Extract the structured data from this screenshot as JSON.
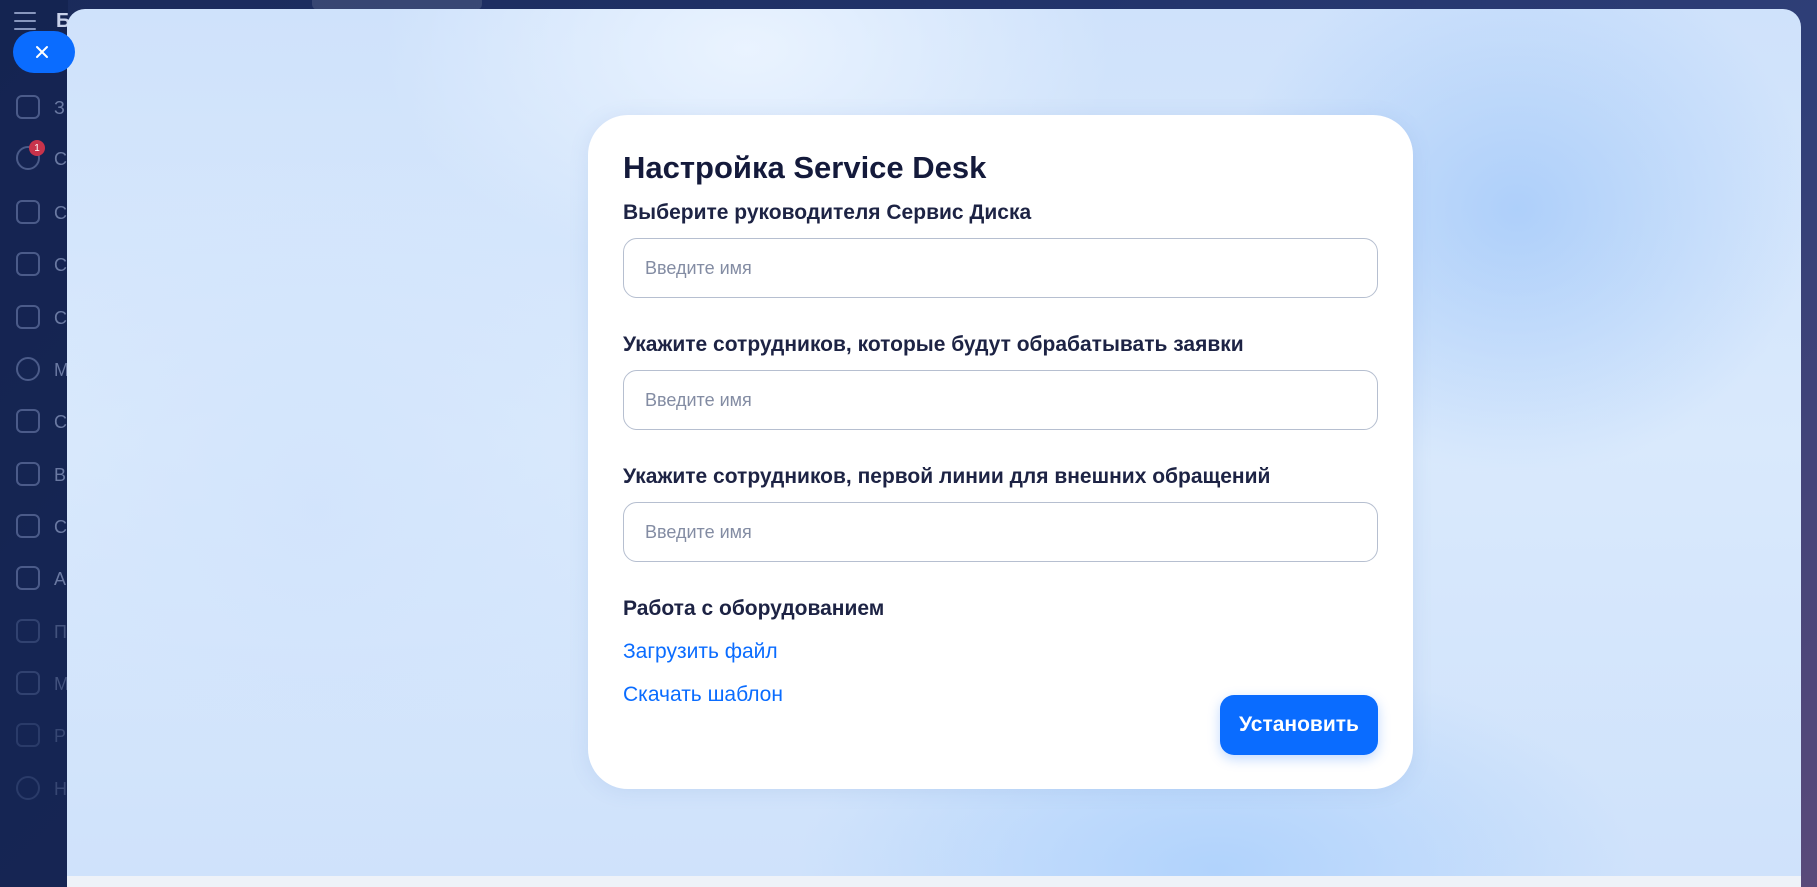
{
  "background": {
    "app_letter": "Б",
    "nav_badge": "1",
    "nav_items": [
      "З",
      "С",
      "С",
      "С",
      "С",
      "М",
      "С",
      "В",
      "С",
      "А",
      "П",
      "М",
      "Р",
      "Н"
    ]
  },
  "slider": {
    "title": "Настройка Service Desk",
    "fields": [
      {
        "label": "Выберите руководителя Сервис Диска",
        "placeholder": "Введите имя",
        "value": ""
      },
      {
        "label": "Укажите сотрудников, которые будут обрабатывать заявки",
        "placeholder": "Введите имя",
        "value": ""
      },
      {
        "label": "Укажите сотрудников, первой линии для внешних обращений",
        "placeholder": "Введите имя",
        "value": ""
      }
    ],
    "equipment": {
      "label": "Работа с оборудованием",
      "upload_link": "Загрузить файл",
      "template_link": "Скачать шаблон"
    },
    "install_button": "Установить"
  },
  "colors": {
    "accent": "#0a6cff",
    "title": "#141a3b",
    "label": "#1d2344",
    "placeholder": "#838ca3"
  },
  "icons": {
    "close": "close-icon",
    "menu": "hamburger-menu-icon"
  }
}
